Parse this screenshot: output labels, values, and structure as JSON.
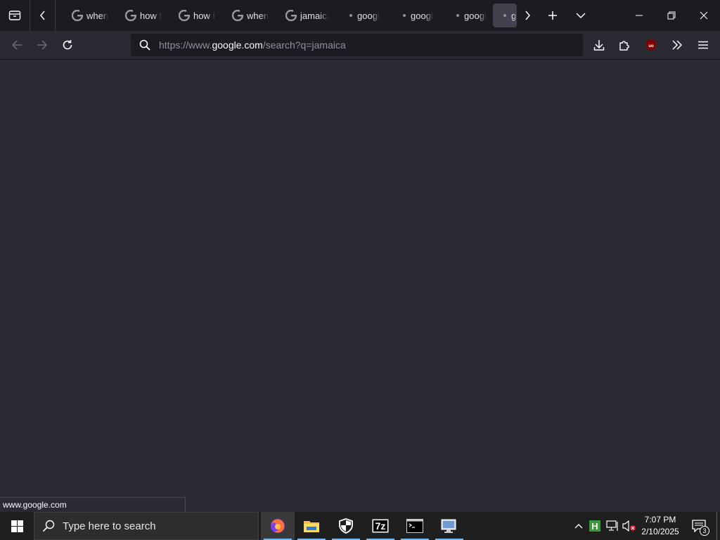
{
  "tabs": [
    {
      "label": "when",
      "icon": "google-favicon-icon"
    },
    {
      "label": "how t",
      "icon": "google-favicon-icon"
    },
    {
      "label": "how t",
      "icon": "google-favicon-icon"
    },
    {
      "label": "when",
      "icon": "google-favicon-icon"
    },
    {
      "label": "jamaica",
      "icon": "google-favicon-icon"
    },
    {
      "label": "googl",
      "icon": "loading-dot-icon"
    },
    {
      "label": "googl",
      "icon": "loading-dot-icon"
    },
    {
      "label": "googl",
      "icon": "loading-dot-icon"
    },
    {
      "label": "g",
      "icon": "loading-dot-icon",
      "active": true
    }
  ],
  "urlbar": {
    "prefix": "https://www.",
    "host": "google.com",
    "path": "/search?q=jamaica"
  },
  "status_link": "www.google.com",
  "taskbar": {
    "search_placeholder": "Type here to search",
    "apps": [
      "firefox-icon",
      "file-explorer-icon",
      "windows-security-icon",
      "7zip-icon",
      "terminal-icon",
      "remote-desktop-icon"
    ],
    "sevenzip_label": "7z",
    "clock_time": "7:07 PM",
    "clock_date": "2/10/2025",
    "notification_count": "3"
  },
  "colors": {
    "tabstrip_bg": "#1c1b22",
    "toolbar_bg": "#2b2a33",
    "taskbar_bg": "#1f1f1f",
    "accent": "#76b9ed"
  }
}
